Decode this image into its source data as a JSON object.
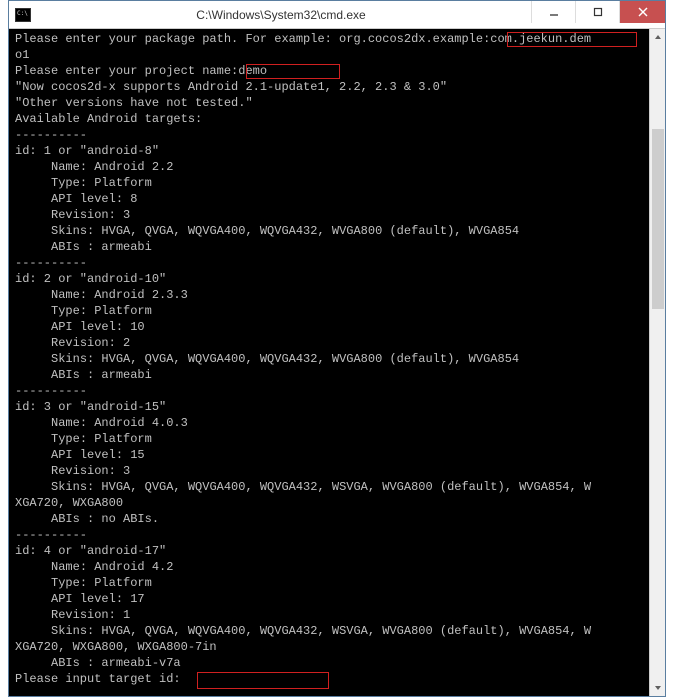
{
  "window": {
    "title": "C:\\Windows\\System32\\cmd.exe"
  },
  "highlights": {
    "pkg_input": "com.jeekun.dem",
    "name_input": "demo",
    "target_input": ""
  },
  "terminal_lines": [
    "Please enter your package path. For example: org.cocos2dx.example:com.jeekun.dem",
    "o1",
    "Please enter your project name:demo",
    "\"Now cocos2d-x supports Android 2.1-update1, 2.2, 2.3 & 3.0\"",
    "\"Other versions have not tested.\"",
    "Available Android targets:",
    "----------",
    "id: 1 or \"android-8\"",
    "     Name: Android 2.2",
    "     Type: Platform",
    "     API level: 8",
    "     Revision: 3",
    "     Skins: HVGA, QVGA, WQVGA400, WQVGA432, WVGA800 (default), WVGA854",
    "     ABIs : armeabi",
    "----------",
    "id: 2 or \"android-10\"",
    "     Name: Android 2.3.3",
    "     Type: Platform",
    "     API level: 10",
    "     Revision: 2",
    "     Skins: HVGA, QVGA, WQVGA400, WQVGA432, WVGA800 (default), WVGA854",
    "     ABIs : armeabi",
    "----------",
    "id: 3 or \"android-15\"",
    "     Name: Android 4.0.3",
    "     Type: Platform",
    "     API level: 15",
    "     Revision: 3",
    "     Skins: HVGA, QVGA, WQVGA400, WQVGA432, WSVGA, WVGA800 (default), WVGA854, W",
    "XGA720, WXGA800",
    "     ABIs : no ABIs.",
    "----------",
    "id: 4 or \"android-17\"",
    "     Name: Android 4.2",
    "     Type: Platform",
    "     API level: 17",
    "     Revision: 1",
    "     Skins: HVGA, QVGA, WQVGA400, WQVGA432, WSVGA, WVGA800 (default), WVGA854, W",
    "XGA720, WXGA800, WXGA800-7in",
    "     ABIs : armeabi-v7a",
    "Please input target id:"
  ]
}
